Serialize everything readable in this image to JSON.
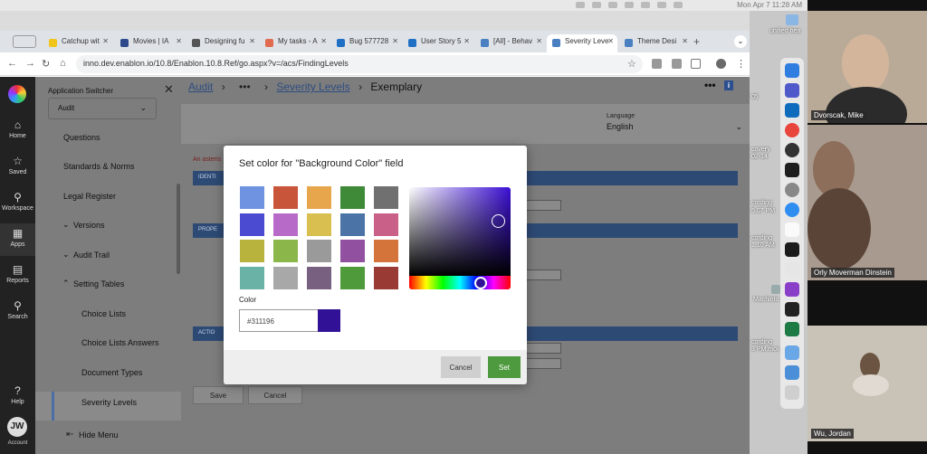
{
  "mac_menubar": {
    "time": "Mon Apr 7  11:28 AM"
  },
  "browser": {
    "tabs": [
      {
        "label": "Catchup wit",
        "color": "#f0c419"
      },
      {
        "label": "Movies | IA",
        "color": "#2d4b8c"
      },
      {
        "label": "Designing fu",
        "color": "#555555"
      },
      {
        "label": "My tasks - A",
        "color": "#e06b4f"
      },
      {
        "label": "Bug 577728",
        "color": "#1f6fc5"
      },
      {
        "label": "User Story 5",
        "color": "#1f6fc5"
      },
      {
        "label": "[All] - Behav",
        "color": "#4a7fc1"
      },
      {
        "label": "Severity Leve",
        "color": "#4a7fc1"
      },
      {
        "label": "Theme Desi",
        "color": "#4a7fc1"
      }
    ],
    "url": "inno.dev.enablon.io/10.8/Enablon.10.8.Ref/go.aspx?v=/acs/FindingLevels"
  },
  "left_nav": {
    "items": [
      {
        "label": "Home",
        "icon": "⌂"
      },
      {
        "label": "Saved",
        "icon": "☆"
      },
      {
        "label": "Workspace",
        "icon": "⚲"
      },
      {
        "label": "Apps",
        "icon": "▦"
      },
      {
        "label": "Reports",
        "icon": "▤"
      },
      {
        "label": "Search",
        "icon": "⚲"
      },
      {
        "label": "Help",
        "icon": "?"
      }
    ],
    "avatar": "JW",
    "account": "Account"
  },
  "menu": {
    "title": "Application Switcher",
    "switcher_value": "Audit",
    "items": [
      {
        "label": "Questions"
      },
      {
        "label": "Standards & Norms"
      },
      {
        "label": "Legal Register"
      },
      {
        "label": "Versions",
        "chev": "⌄"
      },
      {
        "label": "Audit Trail",
        "chev": "⌄"
      },
      {
        "label": "Setting Tables",
        "chev": "⌃"
      },
      {
        "label": "Choice Lists"
      },
      {
        "label": "Choice Lists Answers"
      },
      {
        "label": "Document Types"
      },
      {
        "label": "Severity Levels"
      }
    ],
    "hide_menu": "Hide Menu"
  },
  "content": {
    "breadcrumb": {
      "root": "Audit",
      "mid": "Severity Levels",
      "current": "Exemplary"
    },
    "language_label": "Language",
    "language_value": "English",
    "asterisk_note": "An asteris",
    "sections": [
      "IDENTI",
      "PROPE",
      "ACTIO"
    ],
    "save": "Save",
    "cancel": "Cancel"
  },
  "modal": {
    "title": "Set color for \"Background Color\" field",
    "swatches": [
      "#6f93e0",
      "#c8553a",
      "#e8a64c",
      "#3f8a38",
      "#707070",
      "#4a4bd0",
      "#b86ac9",
      "#d9bf50",
      "#4b73a6",
      "#c96088",
      "#b8b33c",
      "#8ab64a",
      "#9a9a9a",
      "#9250a0",
      "#d5743a",
      "#6ab2a6",
      "#a8a8a8",
      "#786080",
      "#4f9a3a",
      "#9a3a35"
    ],
    "color_label": "Color",
    "color_value": "#311196",
    "cancel": "Cancel",
    "set": "Set"
  },
  "video": {
    "participants": [
      {
        "name": "Dvorscak, Mike"
      },
      {
        "name": "Orly Moverman Dinstein"
      },
      {
        "name": "Wu, Jordan"
      }
    ]
  },
  "desktop": {
    "labels": [
      "unified hea",
      "05",
      "covery",
      "02-14",
      "cording",
      "5.07 PM",
      "cording",
      "1.10 AM",
      "cording",
      "3.53 PM",
      "Machinto",
      "cording",
      "3 PM.mov"
    ]
  }
}
